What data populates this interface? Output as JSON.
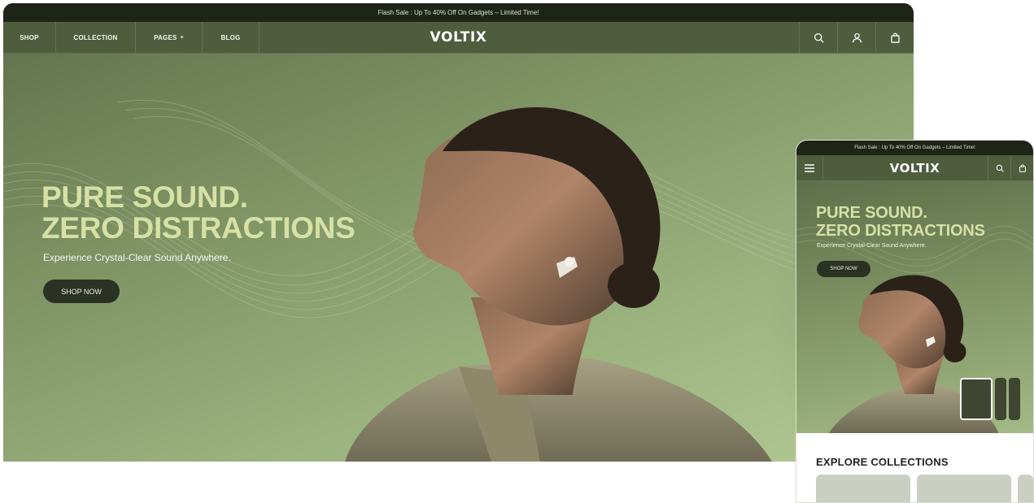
{
  "desktop": {
    "flash_text": "Flash Sale : Up To 40% Off On Gadgets – Limited Time!",
    "nav": {
      "shop": "SHOP",
      "collection": "COLLECTION",
      "pages": "PAGES",
      "blog": "BLOG"
    },
    "logo": "VOLTIX",
    "icons": [
      "search-icon",
      "user-icon",
      "bag-icon"
    ],
    "hero": {
      "title_line1": "PURE SOUND.",
      "title_line2": "ZERO DISTRACTIONS",
      "subtitle": "Experience Crystal-Clear Sound Anywhere.",
      "cta": "SHOP NOW"
    }
  },
  "mobile": {
    "flash_text": "Flash Sale : Up To 40% Off On Gadgets – Limited Time!",
    "logo": "VOLTIX",
    "icons": [
      "menu-icon",
      "search-icon",
      "bag-icon"
    ],
    "hero": {
      "title_line1": "PURE SOUND.",
      "title_line2": "ZERO DISTRACTIONS",
      "subtitle": "Experience Crystal-Clear Sound Anywhere.",
      "cta": "SHOP NOW"
    },
    "explore_title": "EXPLORE COLLECTIONS"
  },
  "colors": {
    "accent_headline": "#d7e0a5",
    "nav_bg": "#4f5d3d",
    "flash_bg": "#1f2419",
    "button_bg": "#2c3223"
  }
}
